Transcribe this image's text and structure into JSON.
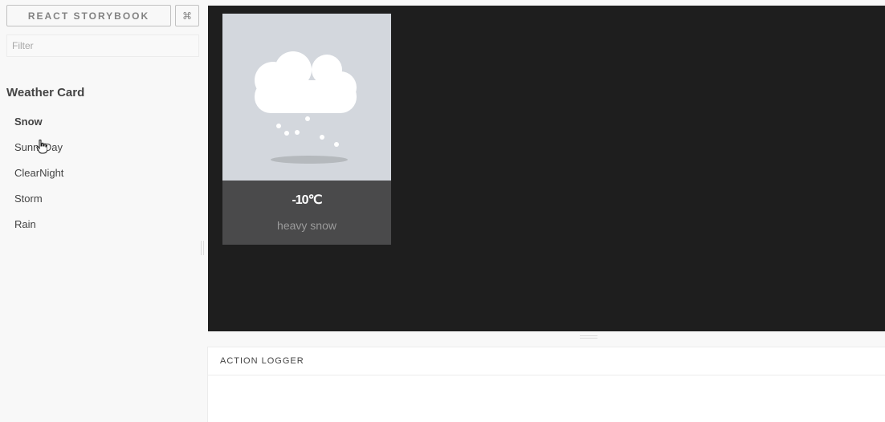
{
  "header": {
    "brand_label": "REACT STORYBOOK",
    "shortcut_label": "⌘"
  },
  "filter": {
    "placeholder": "Filter",
    "value": ""
  },
  "stories": {
    "kind_title": "Weather Card",
    "items": [
      {
        "label": "Snow",
        "selected": true
      },
      {
        "label": "SunnyDay",
        "selected": false
      },
      {
        "label": "ClearNight",
        "selected": false
      },
      {
        "label": "Storm",
        "selected": false
      },
      {
        "label": "Rain",
        "selected": false
      }
    ]
  },
  "preview": {
    "background": "#1e1e1e",
    "card": {
      "temperature": "-10℃",
      "description": "heavy snow",
      "icon": "snow-cloud-icon",
      "illustration_background": "#d3d7dd",
      "info_background": "#4a4a4b"
    }
  },
  "addons": {
    "tabs": [
      {
        "label": "ACTION LOGGER"
      }
    ]
  }
}
